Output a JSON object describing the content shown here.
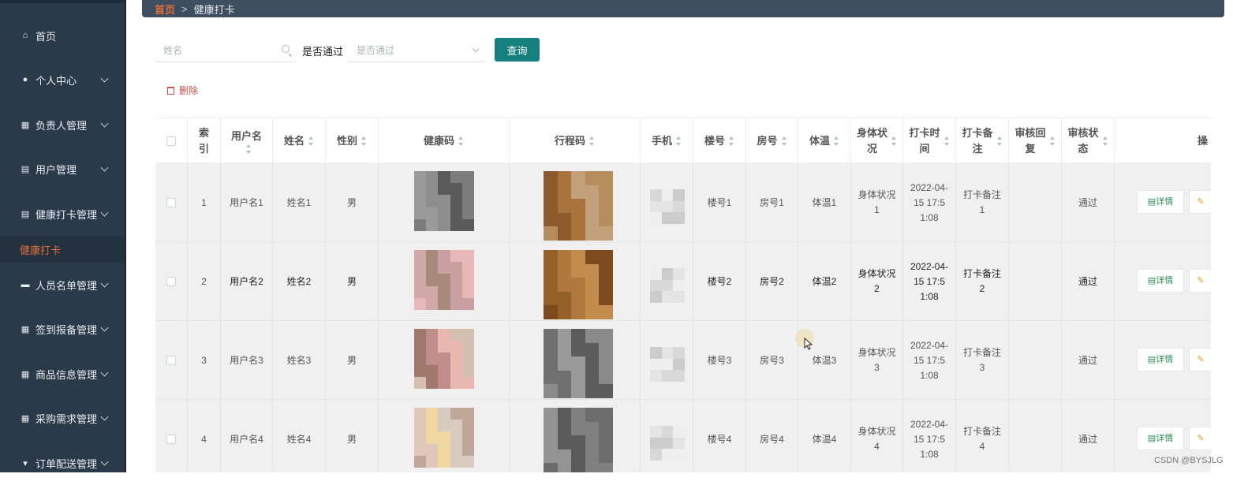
{
  "breadcrumb": {
    "home": "首页",
    "separator": ">",
    "current": "健康打卡"
  },
  "sidebar": {
    "items": [
      {
        "label": "首页",
        "icon": "home-icon",
        "expandable": false
      },
      {
        "label": "个人中心",
        "icon": "user-icon",
        "expandable": true
      },
      {
        "label": "负责人管理",
        "icon": "grid-icon",
        "expandable": true
      },
      {
        "label": "用户管理",
        "icon": "document-icon",
        "expandable": true
      },
      {
        "label": "健康打卡管理",
        "icon": "document-icon",
        "expandable": true
      },
      {
        "label": "人员名单管理",
        "icon": "message-icon",
        "expandable": true
      },
      {
        "label": "签到报备管理",
        "icon": "grid-icon",
        "expandable": true
      },
      {
        "label": "商品信息管理",
        "icon": "grid-icon",
        "expandable": true
      },
      {
        "label": "采购需求管理",
        "icon": "grid-icon",
        "expandable": true
      },
      {
        "label": "订单配送管理",
        "icon": "cart-icon",
        "expandable": true
      }
    ],
    "active_sub": "健康打卡"
  },
  "search": {
    "name_placeholder": "姓名",
    "pass_label": "是否通过",
    "pass_placeholder": "是否通过",
    "query_button": "查询"
  },
  "toolbar": {
    "delete_label": "删除"
  },
  "table": {
    "columns": [
      "索引",
      "用户名",
      "姓名",
      "性别",
      "健康码",
      "行程码",
      "手机",
      "楼号",
      "房号",
      "体温",
      "身体状况",
      "打卡时间",
      "打卡备注",
      "审核回复",
      "审核状态",
      "操"
    ],
    "header_display": {
      "index": "索\n引",
      "username": "用户名",
      "body": "身体状\n况",
      "time": "打卡时\n间",
      "remark": "打卡备\n注",
      "reply": "审核回\n复",
      "status": "审核状\n态"
    },
    "rows": [
      {
        "index": "1",
        "username": "用户名1",
        "name": "姓名1",
        "gender": "男",
        "building": "楼号1",
        "room": "房号1",
        "temperature": "体温1",
        "body": "身体状况\n1",
        "time": "2022-04-\n15 17:5\n1:08",
        "remark": "打卡备注\n1",
        "reply": "",
        "status": "通过"
      },
      {
        "index": "2",
        "username": "用户名2",
        "name": "姓名2",
        "gender": "男",
        "building": "楼号2",
        "room": "房号2",
        "temperature": "体温2",
        "body": "身体状况\n2",
        "time": "2022-04-\n15 17:5\n1:08",
        "remark": "打卡备注\n2",
        "reply": "",
        "status": "通过"
      },
      {
        "index": "3",
        "username": "用户名3",
        "name": "姓名3",
        "gender": "男",
        "building": "楼号3",
        "room": "房号3",
        "temperature": "体温3",
        "body": "身体状况\n3",
        "time": "2022-04-\n15 17:5\n1:08",
        "remark": "打卡备注\n3",
        "reply": "",
        "status": "通过"
      },
      {
        "index": "4",
        "username": "用户名4",
        "name": "姓名4",
        "gender": "男",
        "building": "楼号4",
        "room": "房号4",
        "temperature": "体温4",
        "body": "身体状况\n4",
        "time": "2022-04-\n15 17:5\n1:08",
        "remark": "打卡备注\n4",
        "reply": "",
        "status": "通过"
      }
    ],
    "detail_button": "详情"
  },
  "watermark": "CSDN @BYSJLG",
  "colors": {
    "sidebar_bg": "#2b3a4a",
    "accent": "#e0703a",
    "primary": "#16807f",
    "danger": "#c0504d"
  }
}
